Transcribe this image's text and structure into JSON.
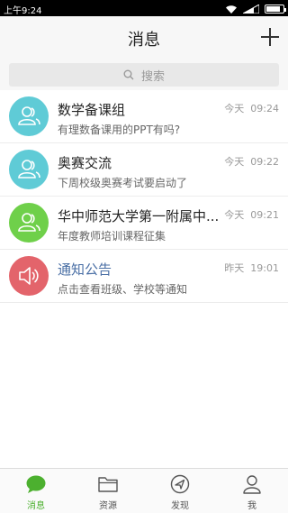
{
  "status_bar": {
    "time": "上午9:24"
  },
  "header": {
    "title": "消息"
  },
  "search": {
    "placeholder": "搜索"
  },
  "conversations": [
    {
      "name": "数学备课组",
      "preview": "有理数备课用的PPT有吗?",
      "day": "今天",
      "time": "09:24",
      "avatar_color": "#5fcbd6",
      "avatar_icon": "group-icon"
    },
    {
      "name": "奥赛交流",
      "preview": "下周校级奥赛考试要启动了",
      "day": "今天",
      "time": "09:22",
      "avatar_color": "#5fcbd6",
      "avatar_icon": "group-icon"
    },
    {
      "name": "华中师范大学第一附属中...",
      "preview": "年度教师培训课程征集",
      "day": "今天",
      "time": "09:21",
      "avatar_color": "#6fd04a",
      "avatar_icon": "group-icon"
    },
    {
      "name": "通知公告",
      "preview": "点击查看班级、学校等通知",
      "day": "昨天",
      "time": "19:01",
      "avatar_color": "#e3646b",
      "avatar_icon": "speaker-icon"
    }
  ],
  "tabs": [
    {
      "label": "消息",
      "icon": "chat-bubble-icon",
      "active": true
    },
    {
      "label": "资源",
      "icon": "folder-icon",
      "active": false
    },
    {
      "label": "发现",
      "icon": "compass-icon",
      "active": false
    },
    {
      "label": "我",
      "icon": "person-icon",
      "active": false
    }
  ],
  "colors": {
    "accent": "#4cb02f",
    "cyan": "#5fcbd6",
    "green": "#6fd04a",
    "red": "#e3646b"
  }
}
